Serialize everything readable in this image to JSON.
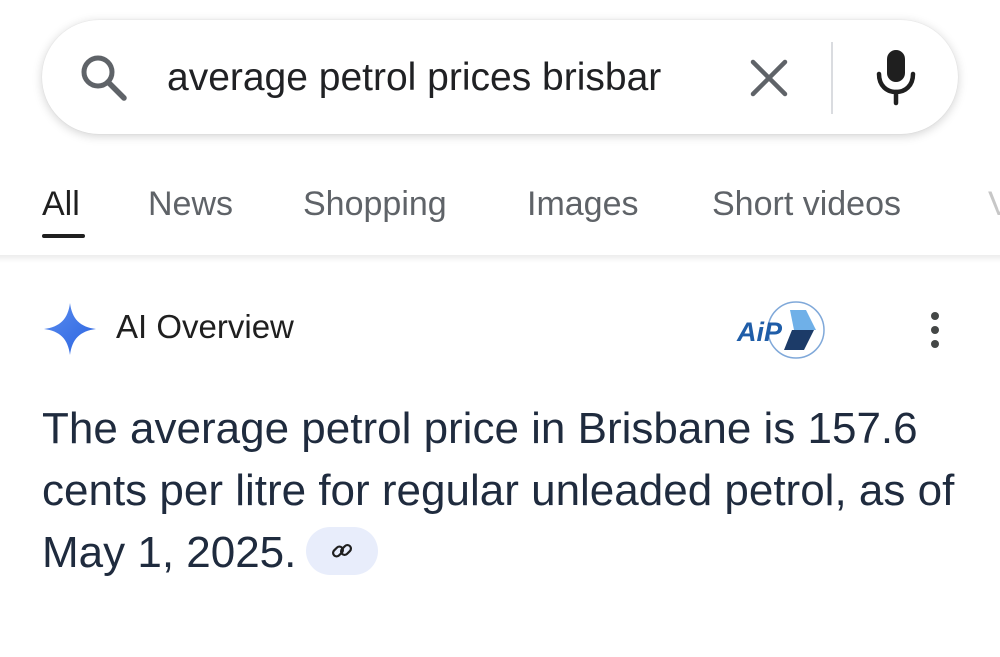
{
  "search": {
    "query": "average petrol prices brisbar",
    "icons": {
      "search": "search-icon",
      "clear": "close-icon",
      "voice": "mic-icon"
    }
  },
  "tabs": [
    {
      "label": "All",
      "active": true
    },
    {
      "label": "News",
      "active": false
    },
    {
      "label": "Shopping",
      "active": false
    },
    {
      "label": "Images",
      "active": false
    },
    {
      "label": "Short videos",
      "active": false
    }
  ],
  "tabs_overflow_glyph": "V",
  "ai_overview": {
    "title": "AI Overview",
    "source_logo_text": "AiP",
    "answer_text": "The average petrol price in Brisbane is 157.6 cents per litre for regular unleaded petrol, as of May 1, 2025.",
    "icons": {
      "star": "sparkle-icon",
      "more": "more-vert-icon",
      "link": "link-icon"
    }
  },
  "colors": {
    "accent_blue": "#4285f4",
    "text_primary": "#1f1f1f",
    "text_secondary": "#5f6368",
    "chip_background": "#e8edfb"
  }
}
